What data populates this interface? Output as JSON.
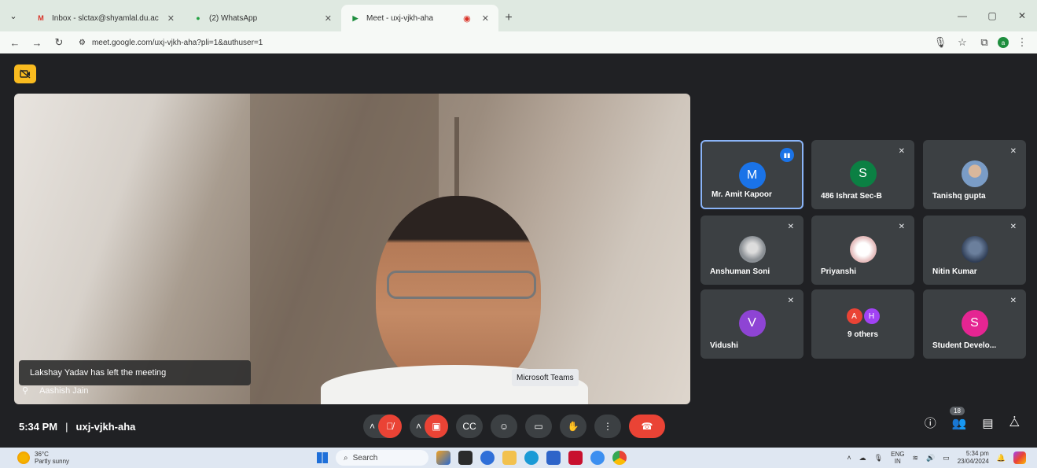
{
  "browser": {
    "tabs": [
      {
        "label": "Inbox - slctax@shyamlal.du.ac",
        "favicon": "M",
        "favicon_color": "#d93025",
        "active": false
      },
      {
        "label": "(2) WhatsApp",
        "favicon": "●",
        "favicon_color": "#25a244",
        "active": false
      },
      {
        "label": "Meet - uxj-vjkh-aha",
        "favicon": "▶",
        "favicon_color": "#1e8e3e",
        "active": true
      }
    ],
    "url": "meet.google.com/uxj-vjkh-aha?pli=1&authuser=1",
    "profile_initial": "a"
  },
  "meet": {
    "main_speaker": "Aashish Jain",
    "toast": "Lakshay Yadav has left the meeting",
    "time": "5:34 PM",
    "separator": "|",
    "code": "uxj-vjkh-aha",
    "participant_count": "18",
    "tooltip": "Microsoft Teams",
    "tiles": [
      {
        "name": "Mr. Amit Kapoor",
        "initial": "M",
        "color": "#1a73e8",
        "speaking": true
      },
      {
        "name": "486 Ishrat Sec-B",
        "initial": "S",
        "color": "#0b8043",
        "speaking": false
      },
      {
        "name": "Tanishq gupta",
        "initial": "",
        "color": "#7a9cc6",
        "speaking": false
      },
      {
        "name": "Anshuman Soni",
        "initial": "",
        "color": "#8a8f94",
        "speaking": false
      },
      {
        "name": "Priyanshi",
        "initial": "",
        "color": "#e9c7c7",
        "speaking": false
      },
      {
        "name": "Nitin Kumar",
        "initial": "",
        "color": "#4a5b78",
        "speaking": false
      },
      {
        "name": "Vidushi",
        "initial": "V",
        "color": "#8e44d4",
        "speaking": false
      },
      {
        "name": "9 others",
        "initial": "",
        "color": "#3c4043",
        "speaking": false
      },
      {
        "name": "Student Develo...",
        "initial": "S",
        "color": "#e52592",
        "speaking": false
      }
    ],
    "others_avatars": [
      {
        "initial": "A",
        "color": "#ea4335"
      },
      {
        "initial": "H",
        "color": "#a142f4"
      }
    ]
  },
  "taskbar": {
    "temperature": "36°C",
    "weather": "Partly sunny",
    "search_placeholder": "Search",
    "lang_top": "ENG",
    "lang_bottom": "IN",
    "clock_time": "5:34 pm",
    "clock_date": "23/04/2024"
  },
  "colors": {
    "meet_bg": "#202124",
    "tile_bg": "#3c4043",
    "mute_red": "#ea4335",
    "accent_blue": "#8ab4f8"
  }
}
